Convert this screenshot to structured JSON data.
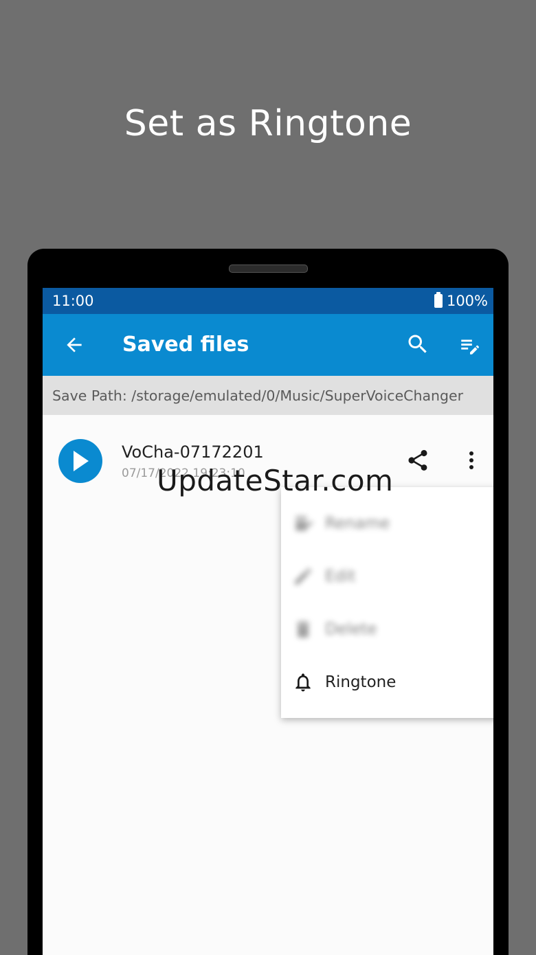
{
  "headline": "Set as Ringtone",
  "status_bar": {
    "time": "11:00",
    "battery": "100%"
  },
  "app_bar": {
    "title": "Saved files"
  },
  "path_bar": {
    "text": "Save Path: /storage/emulated/0/Music/SuperVoiceChanger"
  },
  "file": {
    "name": "VoCha-07172201",
    "date": "07/17/2022   19:23:10"
  },
  "menu": {
    "items": [
      {
        "label": "Rename",
        "icon": "rename-icon"
      },
      {
        "label": "Edit",
        "icon": "edit-icon"
      },
      {
        "label": "Delete",
        "icon": "trash-icon"
      },
      {
        "label": "Ringtone",
        "icon": "bell-icon"
      }
    ]
  },
  "watermark": "UpdateStar.com",
  "colors": {
    "app_bar": "#0a8ad0",
    "status_bar": "#0b5aa1",
    "background": "#6f6f6f"
  }
}
